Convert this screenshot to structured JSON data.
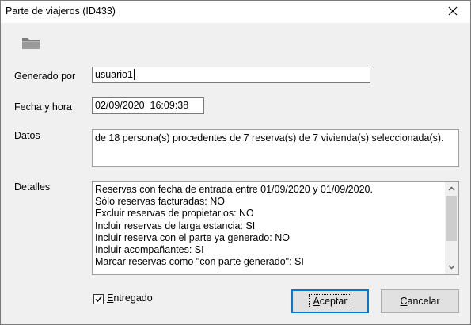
{
  "window": {
    "title": "Parte de viajeros (ID433)",
    "close_glyph": "✕"
  },
  "form": {
    "generado_label": "Generado por",
    "generado_value": "usuario1",
    "fecha_label": "Fecha y hora",
    "fecha_value": "02/09/2020  16:09:38",
    "datos_label": "Datos",
    "datos_value": "de 18 persona(s) procedentes de 7 reserva(s) de 7 vivienda(s) seleccionada(s).",
    "detalles_label": "Detalles",
    "detalles_lines": [
      "Reservas con fecha de entrada entre 01/09/2020 y 01/09/2020.",
      "Sólo reservas facturadas: NO",
      "Excluir reservas de propietarios: NO",
      "Incluir reservas de larga estancia: SI",
      "Incluir reserva con el parte ya generado: NO",
      "Incluir acompañantes: SI",
      "Marcar reservas como \"con parte generado\": SI"
    ]
  },
  "entregado": {
    "label_first": "E",
    "label_rest": "ntregado",
    "checked": true,
    "check_glyph": "✓"
  },
  "buttons": {
    "aceptar_first": "A",
    "aceptar_rest": "ceptar",
    "cancelar_first": "C",
    "cancelar_rest": "ancelar"
  },
  "icons": {
    "folder": "folder-icon",
    "close": "close-icon"
  }
}
